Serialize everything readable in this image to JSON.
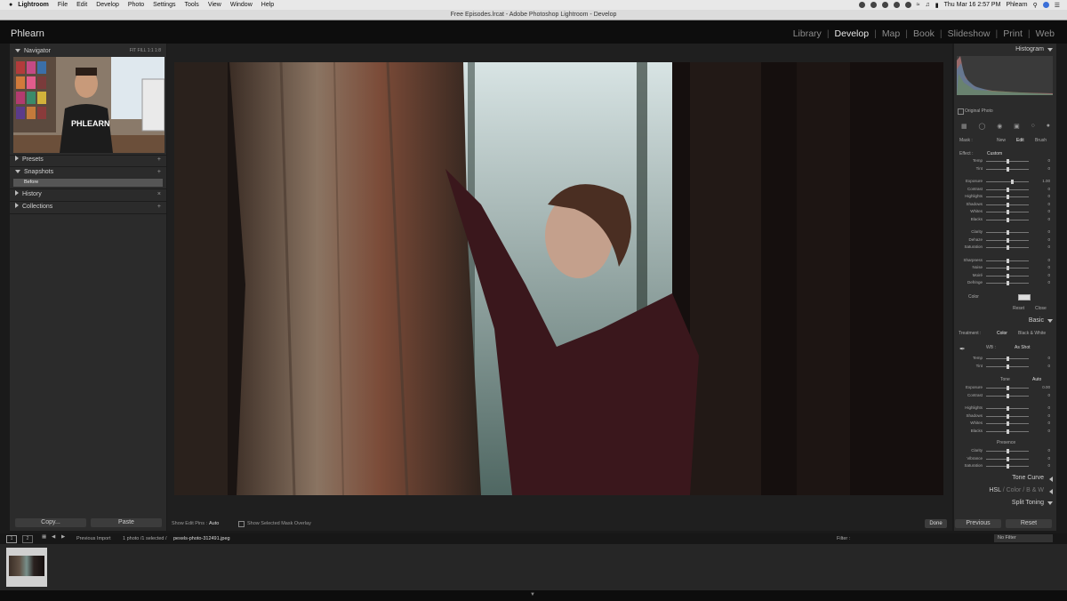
{
  "menubar": {
    "apple": "",
    "app": "Lightroom",
    "items": [
      "File",
      "Edit",
      "Develop",
      "Photo",
      "Settings",
      "Tools",
      "View",
      "Window",
      "Help"
    ],
    "clock": "Thu Mar 16 2:57 PM",
    "user": "Phlearn"
  },
  "window": {
    "title": "Free Episodes.lrcat - Adobe Photoshop Lightroom - Develop"
  },
  "identity_plate": "Phlearn",
  "modules": {
    "library": "Library",
    "develop": "Develop",
    "map": "Map",
    "book": "Book",
    "slideshow": "Slideshow",
    "print": "Print",
    "web": "Web",
    "active": "Develop"
  },
  "left": {
    "navigator": "Navigator",
    "zoom_options": "FIT  FILL  1:1  1:8",
    "presets": "Presets",
    "snapshots": "Snapshots",
    "snapshot_item": "Before",
    "history": "History",
    "collections": "Collections",
    "copy": "Copy...",
    "paste": "Paste"
  },
  "toolbar": {
    "show_edit_pins_label": "Show Edit Pins :",
    "show_edit_pins_value": "Auto",
    "overlay_label": "Show Selected Mask Overlay",
    "done": "Done"
  },
  "right": {
    "histogram": "Histogram",
    "original_photo": "Original Photo",
    "mask_label": "Mask :",
    "mask_new": "New",
    "mask_edit": "Edit",
    "mask_brush": "Brush",
    "effect_label": "Effect :",
    "effect_value": "Custom",
    "mask_sliders": [
      {
        "label": "Temp",
        "value": "0",
        "pos": 0.5
      },
      {
        "label": "Tint",
        "value": "0",
        "pos": 0.5
      },
      {
        "label": "Exposure",
        "value": "1.00",
        "pos": 0.62
      },
      {
        "label": "Contrast",
        "value": "0",
        "pos": 0.5
      },
      {
        "label": "Highlights",
        "value": "0",
        "pos": 0.5
      },
      {
        "label": "Shadows",
        "value": "0",
        "pos": 0.5
      },
      {
        "label": "Whites",
        "value": "0",
        "pos": 0.5
      },
      {
        "label": "Blacks",
        "value": "0",
        "pos": 0.5
      },
      {
        "label": "Clarity",
        "value": "0",
        "pos": 0.5
      },
      {
        "label": "Dehaze",
        "value": "0",
        "pos": 0.5
      },
      {
        "label": "Saturation",
        "value": "0",
        "pos": 0.5
      },
      {
        "label": "Sharpness",
        "value": "0",
        "pos": 0.5
      },
      {
        "label": "Noise",
        "value": "0",
        "pos": 0.5
      },
      {
        "label": "Moiré",
        "value": "0",
        "pos": 0.5
      },
      {
        "label": "Defringe",
        "value": "0",
        "pos": 0.5
      }
    ],
    "color_label": "Color",
    "reset": "Reset",
    "close": "Close",
    "basic": "Basic",
    "treatment_label": "Treatment :",
    "treatment_color": "Color",
    "treatment_bw": "Black & White",
    "wb_label": "WB :",
    "wb_value": "As Shot",
    "basic_wb": [
      {
        "label": "Temp",
        "value": "0",
        "pos": 0.5
      },
      {
        "label": "Tint",
        "value": "0",
        "pos": 0.5
      }
    ],
    "tone_label": "Tone",
    "auto": "Auto",
    "basic_tone": [
      {
        "label": "Exposure",
        "value": "0.00",
        "pos": 0.5
      },
      {
        "label": "Contrast",
        "value": "0",
        "pos": 0.5
      },
      {
        "label": "Highlights",
        "value": "0",
        "pos": 0.5
      },
      {
        "label": "Shadows",
        "value": "0",
        "pos": 0.5
      },
      {
        "label": "Whites",
        "value": "0",
        "pos": 0.5
      },
      {
        "label": "Blacks",
        "value": "0",
        "pos": 0.5
      }
    ],
    "presence_label": "Presence",
    "basic_presence": [
      {
        "label": "Clarity",
        "value": "0",
        "pos": 0.5
      },
      {
        "label": "Vibrance",
        "value": "0",
        "pos": 0.5
      },
      {
        "label": "Saturation",
        "value": "0",
        "pos": 0.5
      }
    ],
    "tone_curve": "Tone Curve",
    "hsl": "HSL",
    "color": "Color",
    "bw": "B & W",
    "split_toning": "Split Toning",
    "previous": "Previous",
    "reset_btn": "Reset"
  },
  "filmbar": {
    "source": "Previous Import",
    "count": "1 photo /1 selected /",
    "filename": "pexels-photo-312491.jpeg",
    "filter_label": "Filter :",
    "filter_value": "No Filter"
  },
  "colors": {
    "accent": "#e8e8e8",
    "panel": "#2b2b2b",
    "background": "#1f1f1f"
  }
}
